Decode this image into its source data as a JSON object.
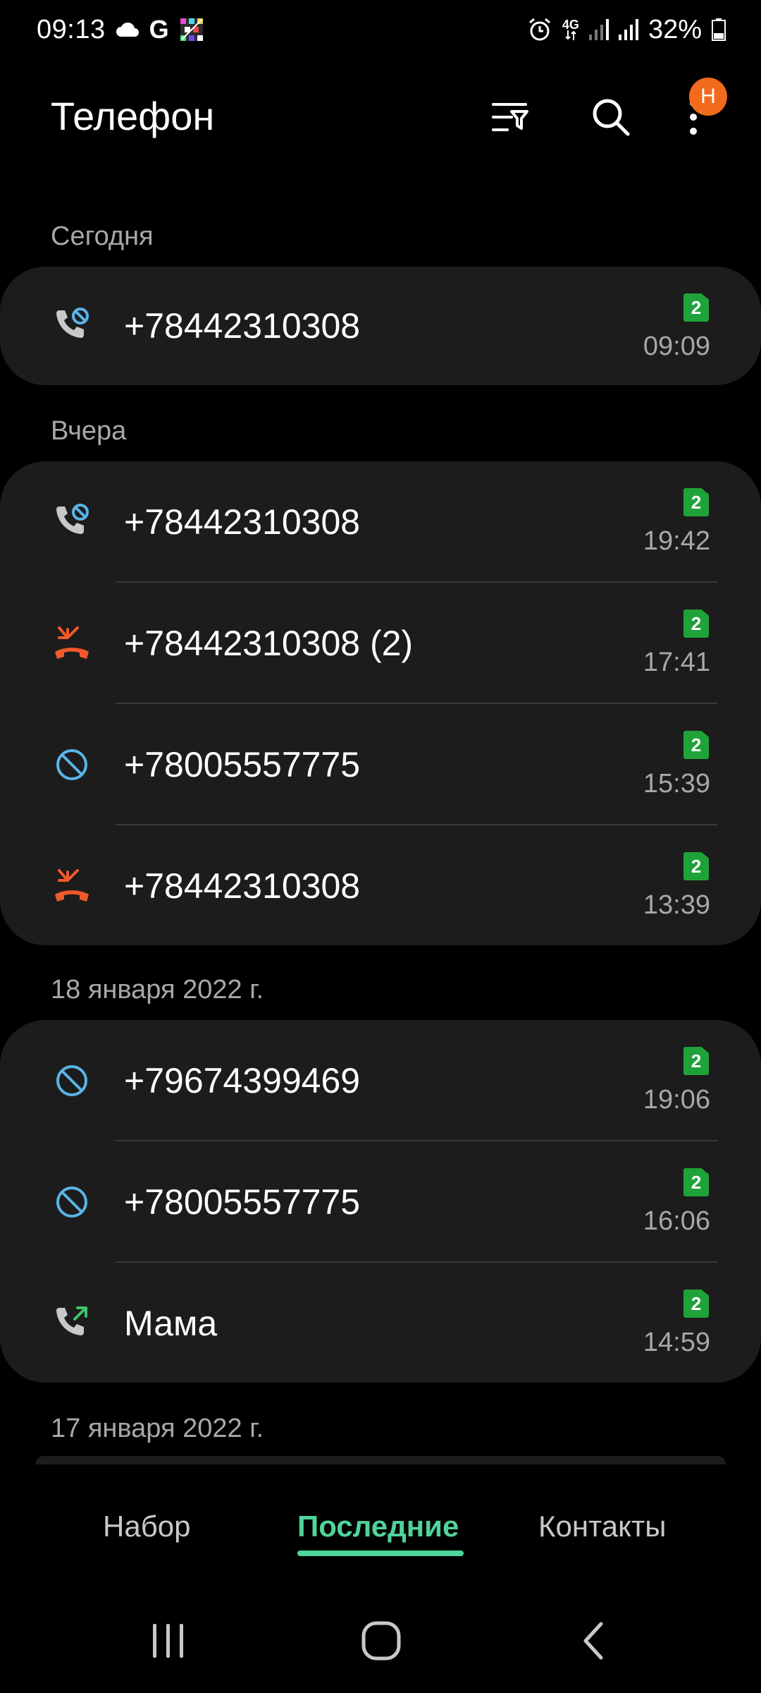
{
  "status_bar": {
    "time": "09:13",
    "g_label": "G",
    "network_type": "4G",
    "battery_percent": "32%",
    "icons": [
      "cloud-icon",
      "google-icon",
      "app-notification-icon",
      "alarm-icon",
      "network-4g-icon",
      "signal-icon",
      "signal-icon",
      "battery-icon"
    ]
  },
  "header": {
    "title": "Телефон",
    "notification_badge": "Н",
    "icons": [
      "filter-icon",
      "search-icon",
      "more-options-icon"
    ]
  },
  "sections": [
    {
      "title": "Сегодня",
      "calls": [
        {
          "name": "+78442310308",
          "time": "09:09",
          "sim": "2",
          "type": "blocked-call"
        }
      ]
    },
    {
      "title": "Вчера",
      "calls": [
        {
          "name": "+78442310308",
          "time": "19:42",
          "sim": "2",
          "type": "blocked-call"
        },
        {
          "name": "+78442310308 (2)",
          "time": "17:41",
          "sim": "2",
          "type": "missed-call"
        },
        {
          "name": "+78005557775",
          "time": "15:39",
          "sim": "2",
          "type": "blocked"
        },
        {
          "name": "+78442310308",
          "time": "13:39",
          "sim": "2",
          "type": "missed-call"
        }
      ]
    },
    {
      "title": "18 января 2022 г.",
      "calls": [
        {
          "name": "+79674399469",
          "time": "19:06",
          "sim": "2",
          "type": "blocked"
        },
        {
          "name": "+78005557775",
          "time": "16:06",
          "sim": "2",
          "type": "blocked"
        },
        {
          "name": "Мама",
          "time": "14:59",
          "sim": "2",
          "type": "outgoing-call"
        }
      ]
    },
    {
      "title": "17 января 2022 г.",
      "calls": []
    }
  ],
  "tabs": {
    "dial": "Набор",
    "recent": "Последние",
    "contacts": "Контакты",
    "active": "recent"
  },
  "colors": {
    "background": "#000000",
    "card": "#1c1c1c",
    "accent": "#4fd49a",
    "missed": "#f05a2a",
    "blocked": "#5ab4e8",
    "sim_badge": "#1fa23a",
    "badge": "#f26a1b"
  }
}
